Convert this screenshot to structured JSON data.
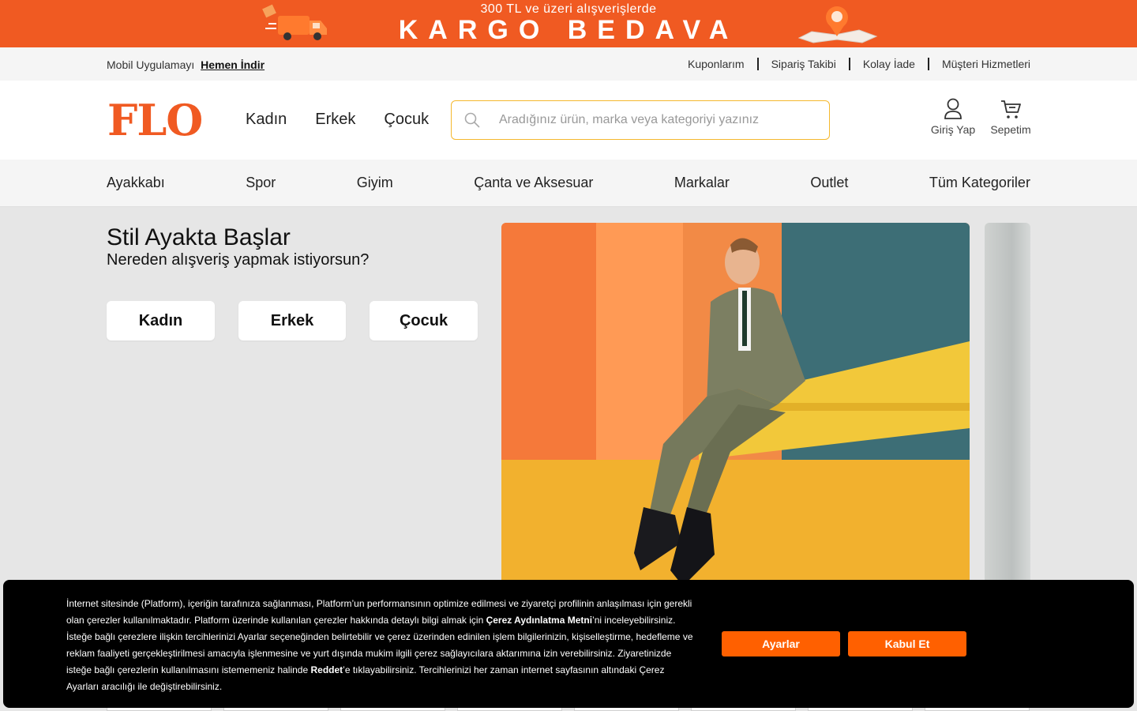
{
  "promo": {
    "line1": "300 TL ve üzeri alışverişlerde",
    "line2": "KARGO BEDAVA",
    "truck_icon": "delivery-truck-icon",
    "pin_icon": "map-pin-icon",
    "color": "#f05a22"
  },
  "utility": {
    "app_prefix": "Mobil Uygulamayı",
    "app_link": "Hemen İndir",
    "links": [
      "Kuponlarım",
      "Sipariş Takibi",
      "Kolay İade",
      "Müşteri Hizmetleri"
    ]
  },
  "header": {
    "logo": "FLO",
    "gender_nav": [
      "Kadın",
      "Erkek",
      "Çocuk"
    ],
    "search_placeholder": "Aradığınız ürün, marka veya kategoriyi yazınız",
    "login_label": "Giriş Yap",
    "cart_label": "Sepetim"
  },
  "category_nav": [
    "Ayakkabı",
    "Spor",
    "Giyim",
    "Çanta ve Aksesuar",
    "Markalar",
    "Outlet",
    "Tüm Kategoriler"
  ],
  "hero": {
    "title": "Stil Ayakta Başlar",
    "subtitle": "Nereden alışveriş yapmak istiyorsun?",
    "buttons": [
      "Kadın",
      "Erkek",
      "Çocuk"
    ]
  },
  "cookie": {
    "text_1": "İnternet sitesinde (Platform), içeriğin tarafınıza sağlanması, Platform’un performansının optimize edilmesi ve ziyaretçi profilinin anlaşılması için gerekli olan çerezler kullanılmaktadır. Platform üzerinde kullanılan çerezler hakkında detaylı bilgi almak için ",
    "link_1": "Çerez Aydınlatma Metni",
    "text_2": "’ni inceleyebilirsiniz. İsteğe bağlı çerezlere ilişkin tercihlerinizi Ayarlar seçeneğinden belirtebilir ve çerez üzerinden edinilen işlem bilgilerinizin, kişiselleştirme, hedefleme ve reklam faaliyeti gerçekleştirilmesi amacıyla işlenmesine ve yurt dışında mukim ilgili çerez sağlayıcılara aktarımına izin verebilirsiniz. Ziyaretinizde isteğe bağlı çerezlerin kullanılmasını istememeniz halinde ",
    "link_2": "Reddet",
    "text_3": "’e tıklayabilirsiniz. Tercihlerinizi her zaman internet sayfasının altındaki Çerez Ayarları aracılığı ile değiştirebilirsiniz.",
    "settings_button": "Ayarlar",
    "accept_button": "Kabul Et",
    "button_color": "#ff6000"
  }
}
